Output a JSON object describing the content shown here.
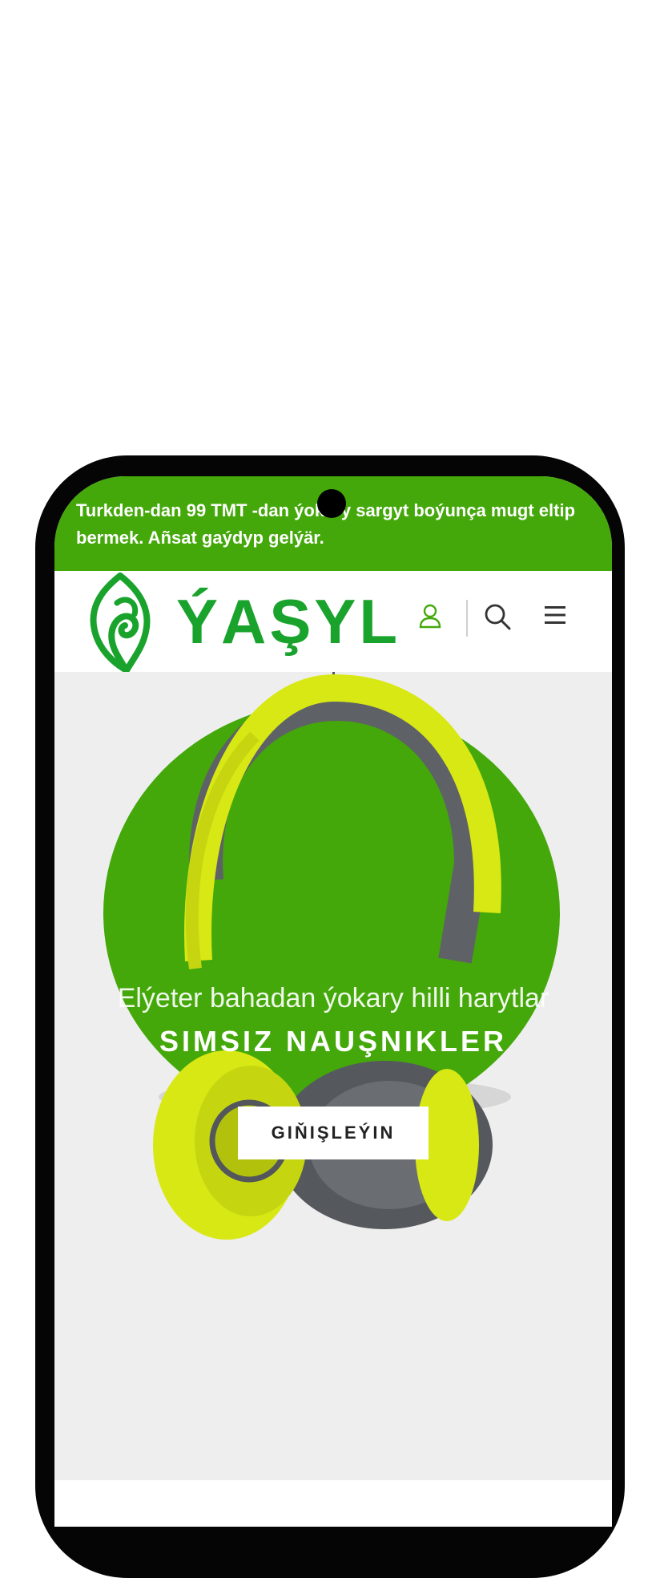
{
  "announcement": {
    "text": "Turkden-dan 99 TMT -dan ýokary sargyt boýunça mugt eltip bermek. Añsat gaýdyp gelýär."
  },
  "header": {
    "logo_text": "ÝAŞYL",
    "icons": [
      "leaf-logo-icon",
      "user-icon",
      "search-icon",
      "menu-icon"
    ]
  },
  "hero": {
    "subtitle": "Elýeter bahadan ýokary hilli harytlar",
    "title": "SIMSIZ NAUŞNIKLER",
    "button_label": "GIŇIŞLEÝIN",
    "slide_count": 2,
    "active_slide": 1
  },
  "colors": {
    "brand_green": "#44a80a",
    "logo_green": "#1aa32c",
    "hero_bg": "#eeeeee",
    "headphone_yellow": "#d8e814"
  }
}
